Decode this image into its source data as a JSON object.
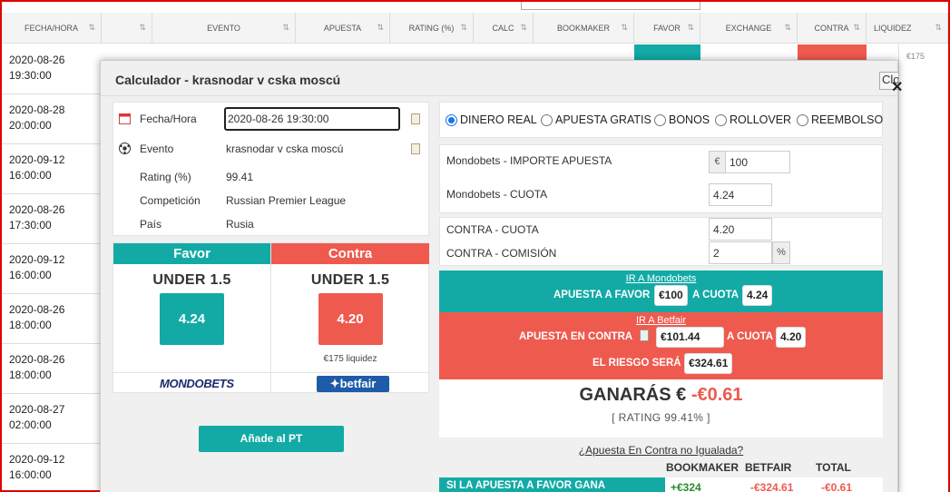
{
  "table": {
    "columns": [
      "FECHA/HORA",
      "",
      "EVENTO",
      "APUESTA",
      "RATING (%)",
      "CALC",
      "BOOKMAKER",
      "FAVOR",
      "EXCHANGE",
      "CONTRA",
      "LIQUIDEZ"
    ],
    "rows": [
      {
        "date": "2020-08-26",
        "time": "19:30:00"
      },
      {
        "date": "2020-08-28",
        "time": "20:00:00"
      },
      {
        "date": "2020-09-12",
        "time": "16:00:00"
      },
      {
        "date": "2020-08-26",
        "time": "17:30:00"
      },
      {
        "date": "2020-09-12",
        "time": "16:00:00"
      },
      {
        "date": "2020-08-26",
        "time": "18:00:00"
      },
      {
        "date": "2020-08-26",
        "time": "18:00:00"
      },
      {
        "date": "2020-08-27",
        "time": "02:00:00"
      },
      {
        "date": "2020-09-12",
        "time": "16:00:00"
      }
    ],
    "liquidez_partial": "€175"
  },
  "modal": {
    "title": "Calculador - krasnodar v cska moscú",
    "close_label": "Close",
    "info": {
      "fecha_label": "Fecha/Hora",
      "fecha_value": "2020-08-26 19:30:00",
      "evento_label": "Evento",
      "evento_value": "krasnodar v cska moscú",
      "rating_label": "Rating (%)",
      "rating_value": "99.41",
      "competicion_label": "Competición",
      "competicion_value": "Russian Premier League",
      "pais_label": "País",
      "pais_value": "Rusia"
    },
    "favor": {
      "header": "Favor",
      "market": "UNDER 1.5",
      "odd": "4.24",
      "logo": "MONDOBETS"
    },
    "contra": {
      "header": "Contra",
      "market": "UNDER 1.5",
      "odd": "4.20",
      "liquidez": "€175 liquidez",
      "logo": "betfair"
    },
    "add_button": "Añade al PT",
    "bet_types": {
      "options": [
        "DINERO REAL",
        "APUESTA GRATIS",
        "BONOS",
        "ROLLOVER",
        "REEMBOLSO"
      ],
      "selected": "DINERO REAL"
    },
    "bookmaker_fields": {
      "importe_label": "Mondobets - IMPORTE APUESTA",
      "currency": "€",
      "importe_value": "100",
      "cuota_label": "Mondobets - CUOTA",
      "cuota_value": "4.24"
    },
    "exchange_fields": {
      "cuota_label": "CONTRA - CUOTA",
      "cuota_value": "4.20",
      "comision_label": "CONTRA - COMISIÓN",
      "comision_value": "2",
      "percent": "%"
    },
    "favor_band": {
      "link": "IR A Mondobets",
      "apuesta_label": "APUESTA A FAVOR",
      "apuesta_value": "€100",
      "cuota_label": "A CUOTA",
      "cuota_value": "4.24"
    },
    "contra_band": {
      "link": "IR A Betfair",
      "apuesta_label": "APUESTA EN CONTRA",
      "apuesta_value": "€101.44",
      "cuota_label": "A CUOTA",
      "cuota_value": "4.20",
      "riesgo_label": "EL RIESGO SERÁ",
      "riesgo_value": "€324.61"
    },
    "result": {
      "label": "GANARÁS €",
      "value": "-€0.61",
      "rating": "[ RATING 99.41% ]"
    },
    "summary": {
      "link": "¿Apuesta En Contra no Igualada?",
      "headers": [
        "BOOKMAKER",
        "BETFAIR",
        "TOTAL"
      ],
      "row_label": "SI LA APUESTA A FAVOR GANA",
      "bookmaker": "+€324",
      "betfair": "-€324.61",
      "total": "-€0.61"
    }
  },
  "colors": {
    "teal": "#13aaa6",
    "red": "#ef5a4f",
    "positive": "#2a8a2a",
    "negative": "#ef5a4f"
  }
}
